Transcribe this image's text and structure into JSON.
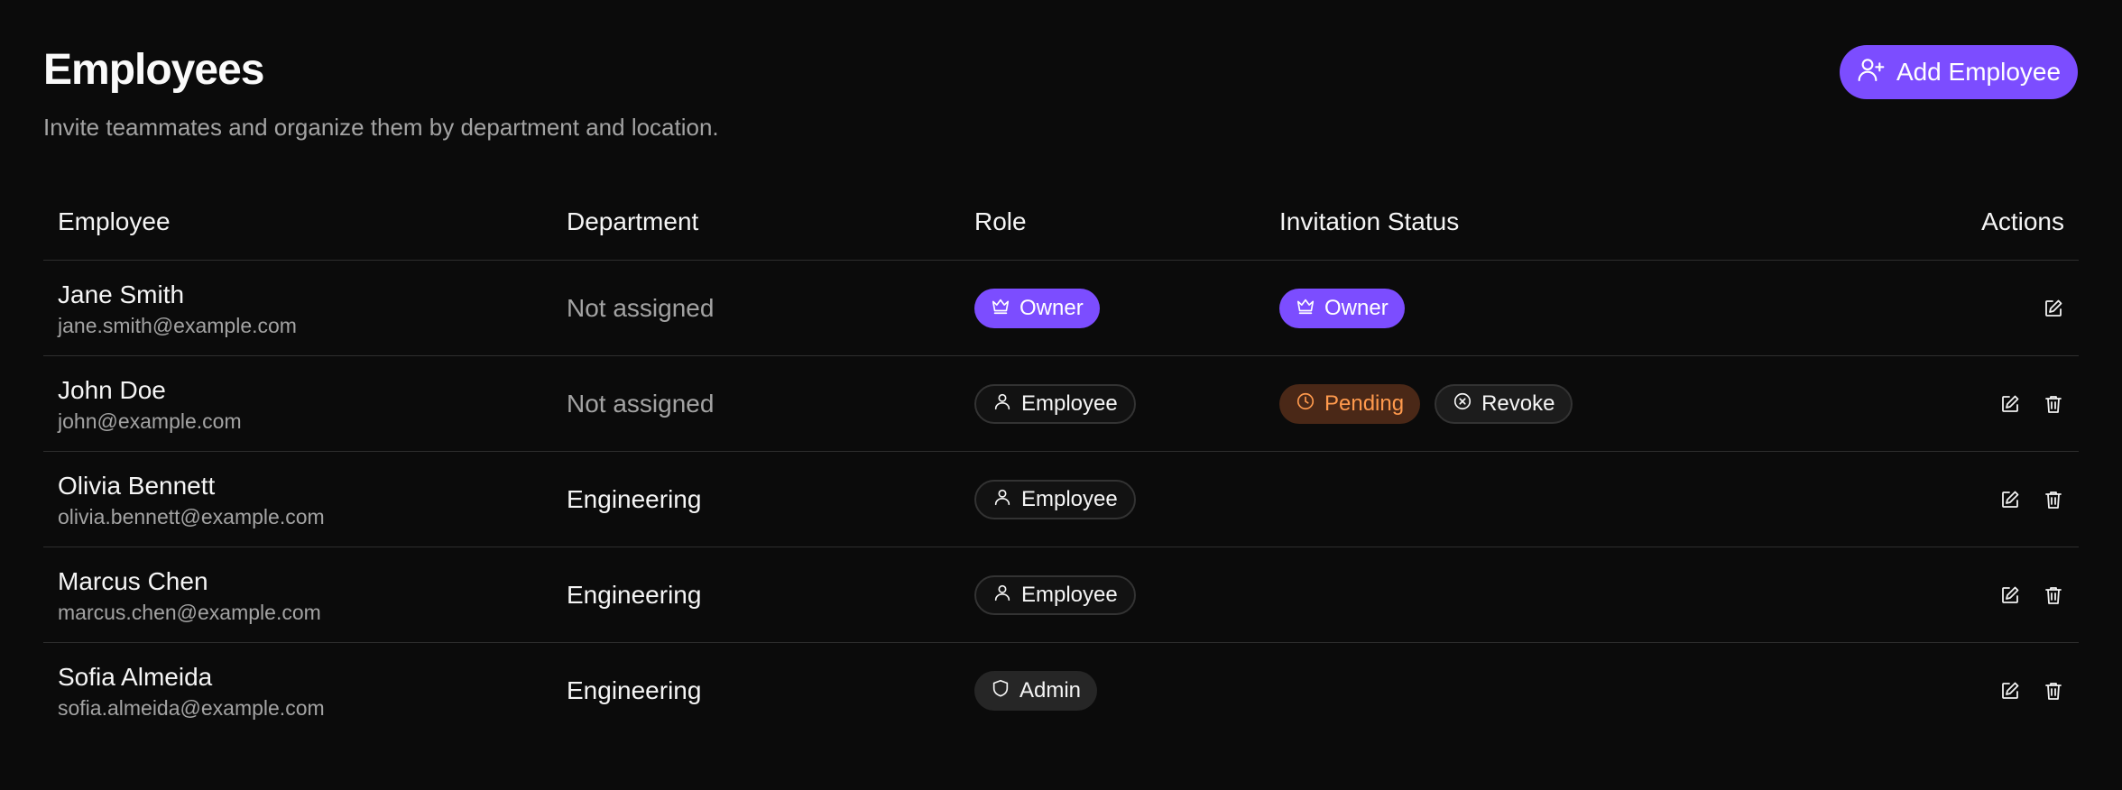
{
  "header": {
    "title": "Employees",
    "subtitle": "Invite teammates and organize them by department and location.",
    "add_button_label": "Add Employee",
    "add_button_icon": "user-plus-icon",
    "accent_color": "#7c4dff"
  },
  "table": {
    "columns": {
      "employee": "Employee",
      "department": "Department",
      "role": "Role",
      "invitation_status": "Invitation Status",
      "actions": "Actions"
    },
    "rows": [
      {
        "name": "Jane Smith",
        "email": "jane.smith@example.com",
        "department": "Not assigned",
        "role": "Owner",
        "role_icon": "crown-icon",
        "status": "Owner",
        "status_icon": "crown-icon",
        "actions": [
          "edit"
        ]
      },
      {
        "name": "John Doe",
        "email": "john@example.com",
        "department": "Not assigned",
        "role": "Employee",
        "role_icon": "user-icon",
        "status": "Pending",
        "status_icon": "clock-icon",
        "revoke_label": "Revoke",
        "revoke_icon": "x-circle-icon",
        "actions": [
          "edit",
          "delete"
        ]
      },
      {
        "name": "Olivia Bennett",
        "email": "olivia.bennett@example.com",
        "department": "Engineering",
        "role": "Employee",
        "role_icon": "user-icon",
        "actions": [
          "edit",
          "delete"
        ]
      },
      {
        "name": "Marcus Chen",
        "email": "marcus.chen@example.com",
        "department": "Engineering",
        "role": "Employee",
        "role_icon": "user-icon",
        "actions": [
          "edit",
          "delete"
        ]
      },
      {
        "name": "Sofia Almeida",
        "email": "sofia.almeida@example.com",
        "department": "Engineering",
        "role": "Admin",
        "role_icon": "shield-icon",
        "actions": [
          "edit",
          "delete"
        ]
      }
    ]
  },
  "colors": {
    "background": "#0b0b0b",
    "owner_badge": "#7c4dff",
    "pending_badge_bg": "#4a2817",
    "pending_badge_text": "#ff9a4d"
  }
}
